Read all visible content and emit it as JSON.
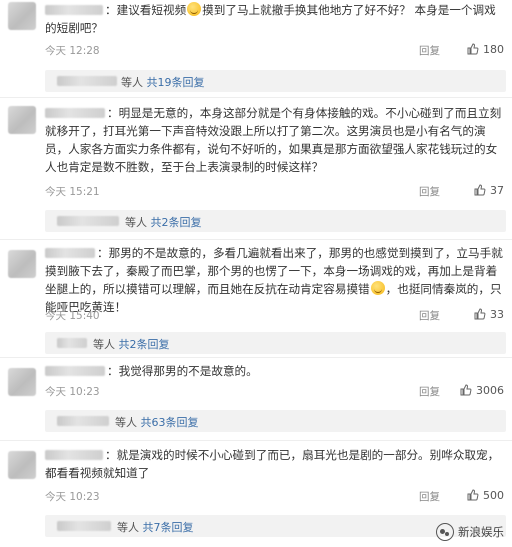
{
  "comments": [
    {
      "text_before": "：建议看短视频",
      "text_after": "摸到了马上就撤手换其他地方了好不好？ 本身是一个调戏的短剧吧？",
      "time": "今天 12:28",
      "reply": "回复",
      "likes": "180",
      "sub_text": "等人 ",
      "sub_count": "共19条回复"
    },
    {
      "text": "：明显是无意的，本身这部分就是个有身体接触的戏。不小心碰到了而且立刻就移开了，打耳光第一下声音特效没跟上所以打了第二次。这男演员也是小有名气的演员，人家各方面实力条件都有，说句不好听的，如果真是那方面欲望强人家花钱玩过的女人也肯定是数不胜数，至于台上表演录制的时候这样？",
      "time": "今天 15:21",
      "reply": "回复",
      "likes": "37",
      "sub_text": "等人 ",
      "sub_count": "共2条回复"
    },
    {
      "text_before": "：那男的不是故意的，多看几遍就看出来了，那男的也感觉到摸到了，立马手就摸到腋下去了，秦殿了而巴掌，那个男的也愣了一下，本身一场调戏的戏，再加上是背着坐腿上的，所以摸错可以理解，而且她在反抗在动肯定容易摸错",
      "text_after": "，也挺同情秦岚的，只能哑巴吃黄连！",
      "time": "今天 15:40",
      "reply": "回复",
      "likes": "33",
      "sub_text": "等人 ",
      "sub_count": "共2条回复"
    },
    {
      "text": "：我觉得那男的不是故意的。",
      "time": "今天 10:23",
      "reply": "回复",
      "likes": "3006",
      "sub_text": "等人 ",
      "sub_count": "共63条回复"
    },
    {
      "text": "：就是演戏的时候不小心碰到了而已，扇耳光也是剧的一部分。别哗众取宠，都看看视频就知道了",
      "time": "今天 10:23",
      "reply": "回复",
      "likes": "500",
      "sub_text": "等人 ",
      "sub_count": "共7条回复"
    }
  ],
  "watermark": "新浪娱乐",
  "icons": {
    "like": "thumbs-up-icon",
    "emoji": "smile-emoji-icon",
    "watermark": "wechat-logo-icon"
  }
}
